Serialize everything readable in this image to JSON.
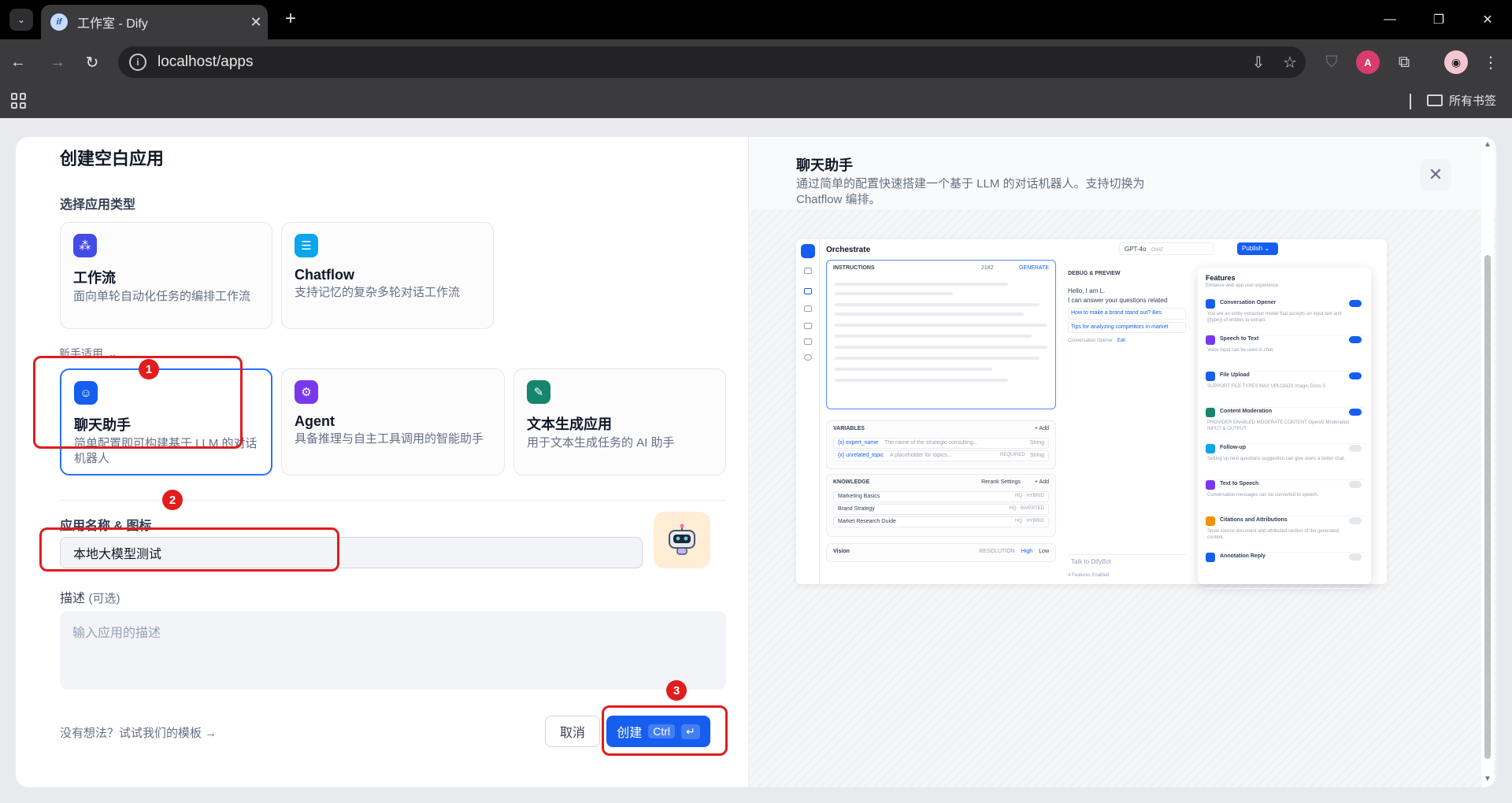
{
  "browser": {
    "tab_title": "工作室 - Dify",
    "favicon_text": "if",
    "url": "localhost/apps",
    "bookmark_folder": "所有书签",
    "profile_initial": "A"
  },
  "modal": {
    "title": "创建空白应用",
    "type_section_label": "选择应用类型",
    "newbie_label": "新手适用",
    "types": [
      {
        "name": "工作流",
        "desc": "面向单轮自动化任务的编排工作流",
        "color": "#444ce7"
      },
      {
        "name": "Chatflow",
        "desc": "支持记忆的复杂多轮对话工作流",
        "color": "#0ba5ec"
      },
      {
        "name": "聊天助手",
        "desc": "简单配置即可构建基于 LLM 的对话机器人",
        "color": "#155eef"
      },
      {
        "name": "Agent",
        "desc": "具备推理与自主工具调用的智能助手",
        "color": "#7839ee"
      },
      {
        "name": "文本生成应用",
        "desc": "用于文本生成任务的 AI 助手",
        "color": "#15856c"
      }
    ],
    "name_label": "应用名称 & 图标",
    "name_value": "本地大模型测试",
    "desc_label": "描述",
    "desc_optional": "(可选)",
    "desc_placeholder": "输入应用的描述",
    "template_link": "没有想法？试试我们的模板 →",
    "cancel": "取消",
    "create": "创建",
    "create_kbd": "Ctrl",
    "create_enter": "↵",
    "accent": "#155eef"
  },
  "annotations": [
    "1",
    "2",
    "3"
  ],
  "preview": {
    "title": "聊天助手",
    "desc": "通过简单的配置快速搭建一个基于 LLM 的对话机器人。支持切换为 Chatflow 编排。",
    "mini": {
      "header": "Orchestrate",
      "model": "GPT-4o",
      "model_tag": "CHAT",
      "publish": "Publish ⌄",
      "instructions": "INSTRUCTIONS",
      "token_count": "2182",
      "generate": "GENERATE",
      "variables": "VARIABLES",
      "add": "+ Add",
      "vars": [
        {
          "key": "{x} expert_name",
          "desc": "The name of the strategic consulting...",
          "type": "String"
        },
        {
          "key": "{x} unrelated_topic",
          "desc": "A placeholder for topics...",
          "tag": "REQUIRED",
          "type": "String"
        }
      ],
      "knowledge": "KNOWLEDGE",
      "rerank": "Rerank Settings",
      "docs": [
        {
          "name": "Marketing Basics",
          "tag": "HQ · HYBRID"
        },
        {
          "name": "Brand Strategy",
          "tag": "HQ · INVERTED"
        },
        {
          "name": "Market Research Guide",
          "tag": "HQ · HYBRID"
        }
      ],
      "vision": "Vision",
      "resolution": "RESOLUTION",
      "high": "High",
      "low": "Low",
      "debug": "DEBUG & PREVIEW",
      "chat_hello": "Hello, I am L.",
      "chat_line": "I can answer your questions related",
      "chat_q1": "How to make a brand stand out?",
      "chat_q1_more": "Bes",
      "chat_q2": "Tips for analyzing competitors in market",
      "opener": "Conversation Opener",
      "opener_edit": "Edit",
      "talk": "Talk to DifyBot",
      "features_enabled": "4 Features Enabled",
      "features_title": "Features",
      "features_sub": "Enhance web app user experience",
      "features": [
        {
          "name": "Conversation Opener",
          "desc": "You are an entity extraction model that accepts an input text and {{type}} of entities to extract.",
          "on": true,
          "color": "#155eef"
        },
        {
          "name": "Speech to Text",
          "desc": "Voice input can be used in chat.",
          "on": true,
          "color": "#7839ee"
        },
        {
          "name": "File Upload",
          "desc": "SUPPORT FILE TYPES   MAX UPLOADS  Image, Docs   3",
          "on": true,
          "color": "#155eef"
        },
        {
          "name": "Content Moderation",
          "desc": "PROVIDER   ENABLED MODERATE CONTENT  OpenAI Moderation   INPUT & OUTPUT",
          "on": true,
          "color": "#15856c"
        },
        {
          "name": "Follow-up",
          "desc": "Setting up next questions suggestion can give users a better chat.",
          "on": false,
          "color": "#0ba5ec"
        },
        {
          "name": "Text to Speech",
          "desc": "Conversation messages can be converted to speech.",
          "on": false,
          "color": "#7839ee"
        },
        {
          "name": "Citations and Attributions",
          "desc": "Show source document and attributed section of the generated content.",
          "on": false,
          "color": "#f79009"
        },
        {
          "name": "Annotation Reply",
          "desc": "",
          "on": false,
          "color": "#155eef"
        }
      ]
    }
  }
}
